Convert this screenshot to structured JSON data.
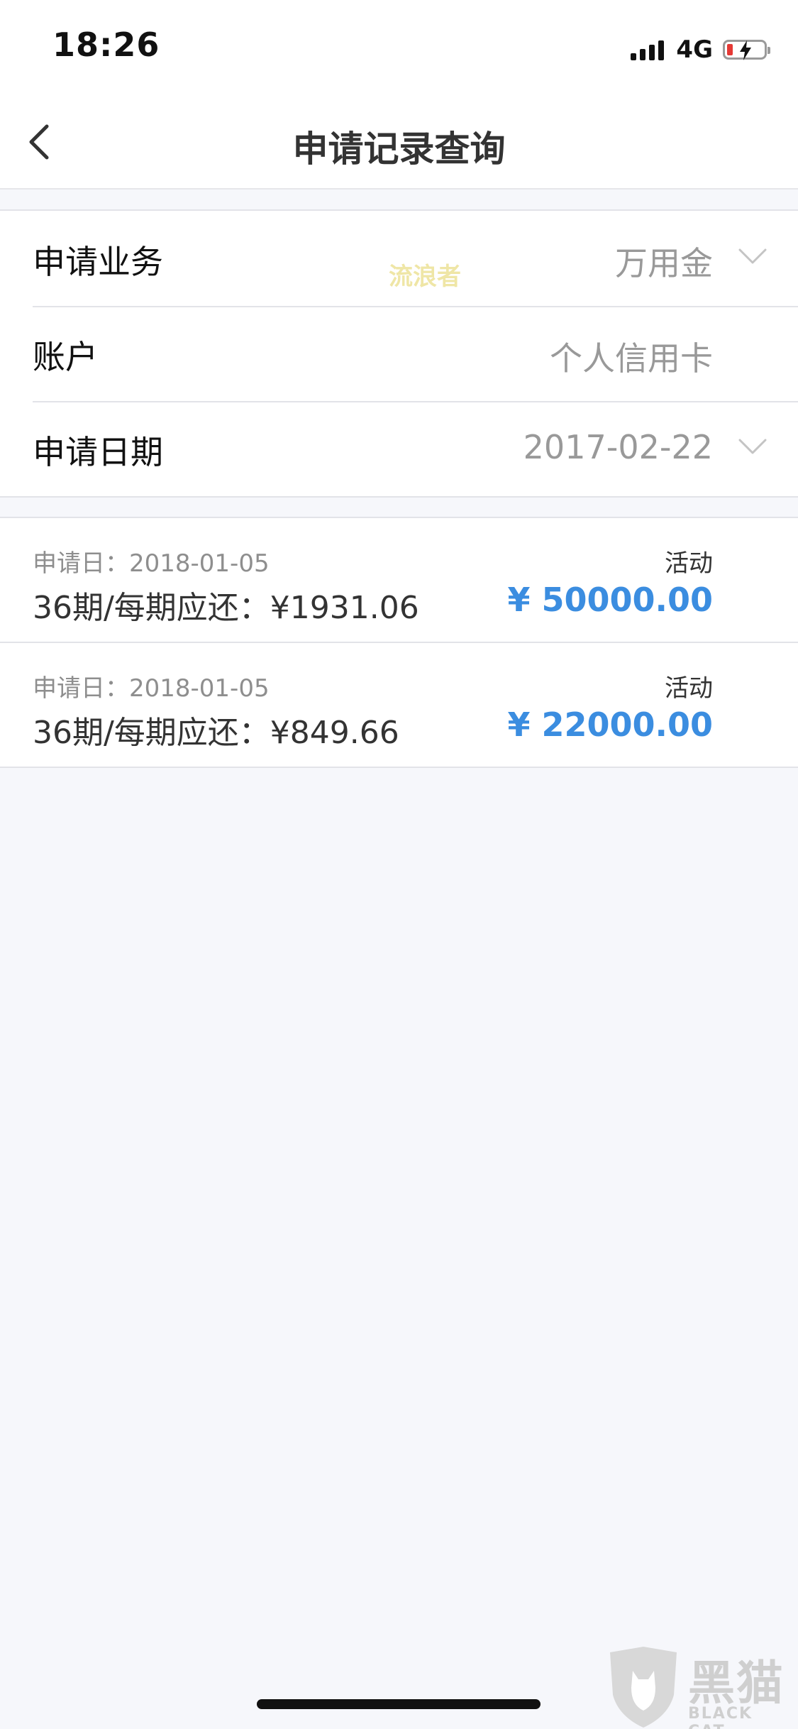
{
  "status_bar": {
    "time": "18:26",
    "network": "4G",
    "battery_level": 0.15,
    "battery_color": "#e53935"
  },
  "nav": {
    "back_icon": "chevron-left-icon",
    "title": "申请记录查询"
  },
  "filters": {
    "business": {
      "label": "申请业务",
      "value": "万用金"
    },
    "account": {
      "label": "账户",
      "value": "个人信用卡"
    },
    "date": {
      "label": "申请日期",
      "value": "2017-02-22"
    }
  },
  "watermark": {
    "text": "流浪者"
  },
  "records": [
    {
      "date": "申请日：2018-01-05",
      "terms": "36期/每期应还：¥1931.06",
      "status": "活动",
      "amount": "¥ 50000.00"
    },
    {
      "date": "申请日：2018-01-05",
      "terms": "36期/每期应还：¥849.66",
      "status": "活动",
      "amount": "¥ 22000.00"
    }
  ],
  "logo": {
    "cn": "黑猫",
    "en": "BLACK CAT"
  },
  "colors": {
    "accent": "#3b8de0",
    "background": "#f6f7fb"
  }
}
